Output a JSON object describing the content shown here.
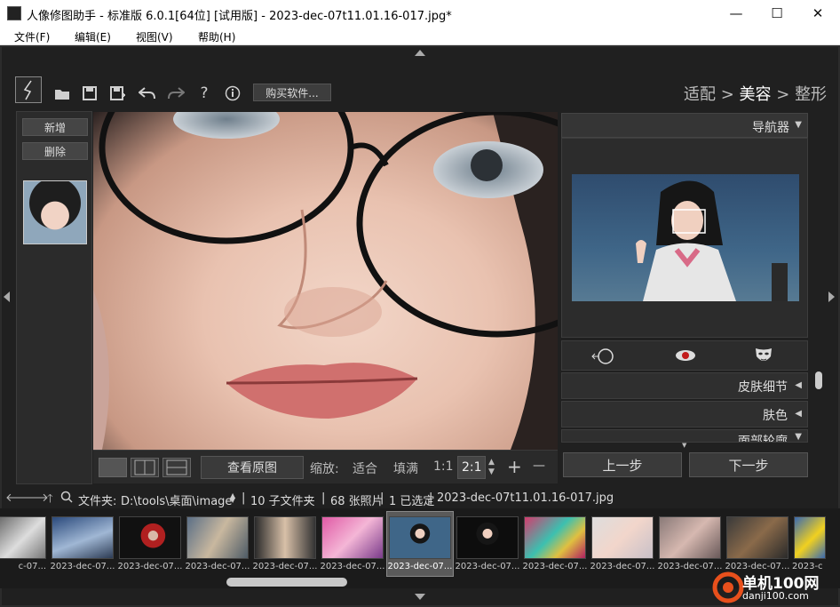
{
  "window": {
    "title": "人像修图助手 - 标准版 6.0.1[64位] [试用版] - 2023-dec-07t11.01.16-017.jpg*",
    "controls": {
      "minimize": "—",
      "maximize": "☐",
      "close": "✕"
    }
  },
  "menu": [
    "文件(F)",
    "编辑(E)",
    "视图(V)",
    "帮助(H)"
  ],
  "toolbar": {
    "buy_label": "购买软件...",
    "icons": [
      "open-folder-icon",
      "save-icon",
      "save-as-icon",
      "undo-icon",
      "redo-icon",
      "help-icon",
      "info-icon"
    ]
  },
  "steps": {
    "step1": "适配",
    "sep1": " > ",
    "step2": "美容",
    "sep2": " > ",
    "step3": "整形",
    "active": "美容"
  },
  "left_panel": {
    "add_label": "新增",
    "delete_label": "删除"
  },
  "view_bar": {
    "show_original": "查看原图",
    "zoom_label": "缩放:",
    "fit": "适合",
    "fill": "填满",
    "ratio_1": "1:1",
    "ratio_2": "2:1",
    "plus": "+",
    "minus": "—"
  },
  "right_panel": {
    "navigator": "导航器",
    "sections": [
      "皮肤细节",
      "肤色",
      "面部轮廓"
    ],
    "prev": "上一步",
    "next": "下一步"
  },
  "path_bar": {
    "folder_label": "文件夹:",
    "path": "D:\\tools\\桌面\\image",
    "subfolders": "10 子文件夹",
    "photos": "68 张照片",
    "selected": "1 已选定",
    "filename": "2023-dec-07t11.01.16-017.jpg"
  },
  "filmstrip": {
    "label": "2023-dec-07...",
    "first_label": "c-07...",
    "last_label": "2023-c",
    "selected_index": 5
  },
  "watermark": {
    "brand": "单机100网",
    "url": "danji100.com"
  }
}
